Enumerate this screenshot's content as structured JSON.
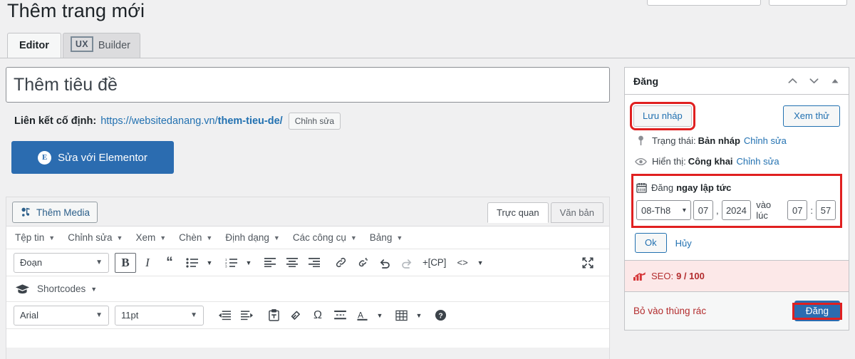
{
  "topbar": {
    "button_1": "",
    "button_2": ""
  },
  "header": {
    "page_title": "Thêm trang mới"
  },
  "tabs": [
    {
      "label": "Editor",
      "active": true
    },
    {
      "badge": "UX",
      "label": "Builder",
      "active": false
    }
  ],
  "editor": {
    "title_placeholder": "Thêm tiêu đề",
    "permalink": {
      "label": "Liên kết cố định:",
      "base_url": "https://websitedanang.vn/",
      "slug": "them-tieu-de",
      "trailing": "/",
      "edit_button": "Chỉnh sửa"
    },
    "elementor_button": "Sửa với Elementor",
    "add_media_button": "Thêm Media",
    "view_tabs": [
      {
        "label": "Trực quan",
        "active": true
      },
      {
        "label": "Văn bản",
        "active": false
      }
    ],
    "menubar": [
      "Tệp tin",
      "Chỉnh sửa",
      "Xem",
      "Chèn",
      "Định dạng",
      "Các công cụ",
      "Bảng"
    ],
    "format_select": "Đoạn",
    "toolbar_icons": [
      "bold-icon",
      "italic-icon",
      "blockquote-icon",
      "bullet-list-icon",
      "numbered-list-icon",
      "align-left-icon",
      "align-center-icon",
      "align-right-icon",
      "link-icon",
      "unlink-icon",
      "undo-icon",
      "redo-icon",
      "code-icon",
      "fullscreen-icon"
    ],
    "custom_button_label": "+[CP]",
    "shortcodes_label": "Shortcodes",
    "font_family": "Arial",
    "font_size": "11pt"
  },
  "sidebar": {
    "panel_title": "Đăng",
    "save_draft_button": "Lưu nháp",
    "preview_button": "Xem thử",
    "status": {
      "label": "Trạng thái:",
      "value": "Bản nháp",
      "edit": "Chỉnh sửa"
    },
    "visibility": {
      "label": "Hiển thị:",
      "value": "Công khai",
      "edit": "Chỉnh sửa"
    },
    "schedule": {
      "label": "Đăng",
      "value": "ngay lập tức",
      "month": "08-Th8",
      "day": "07",
      "comma": ",",
      "year": "2024",
      "at_label": "vào lúc",
      "hour": "07",
      "time_sep": ":",
      "minute": "57",
      "ok_button": "Ok",
      "cancel_link": "Hủy"
    },
    "seo": {
      "label": "SEO:",
      "score": "9 / 100"
    },
    "trash_link": "Bỏ vào thùng rác",
    "publish_button": "Đăng"
  },
  "colors": {
    "accent_blue": "#2b6cb0",
    "link_blue": "#2271b1",
    "highlight_red": "#e02020",
    "seo_red": "#b32d2e",
    "seo_bg": "#fce8e8"
  }
}
